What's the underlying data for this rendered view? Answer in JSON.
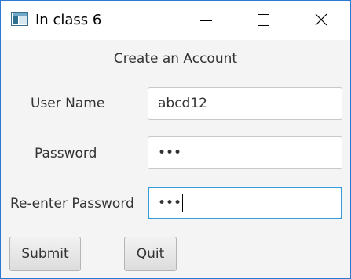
{
  "window": {
    "title": "In class 6",
    "icon": "app-window-icon",
    "controls": [
      "minimize-icon",
      "maximize-icon",
      "close-icon"
    ]
  },
  "form": {
    "heading": "Create an Account",
    "username": {
      "label": "User Name",
      "value": "abcd12"
    },
    "password": {
      "label": "Password",
      "masked_value": "•••"
    },
    "reenter_password": {
      "label": "Re-enter Password",
      "masked_value": "•••",
      "focused": true
    }
  },
  "buttons": {
    "submit": "Submit",
    "quit": "Quit"
  },
  "colors": {
    "window_border": "#2b79d0",
    "focus_ring": "#3a9bdc",
    "background": "#f4f4f4"
  }
}
